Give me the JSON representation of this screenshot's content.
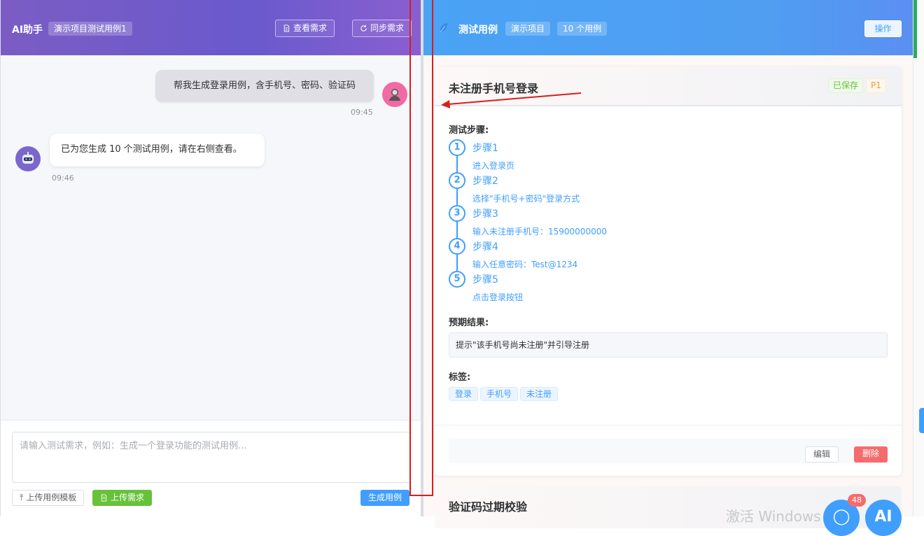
{
  "left_header": {
    "title": "AI助手",
    "project_tag": "演示项目测试用例1",
    "view_req_btn": "查看需求",
    "sync_req_btn": "同步需求"
  },
  "chat": {
    "user_message": "帮我生成登录用例，含手机号、密码、验证码",
    "user_time": "09:45",
    "ai_message": "已为您生成 10 个测试用例，请在右侧查看。",
    "ai_time": "09:46"
  },
  "input": {
    "placeholder": "请输入测试需求，例如：生成一个登录功能的测试用例...",
    "upload_template_btn": "上传用例模板",
    "upload_req_btn": "上传需求",
    "generate_btn": "生成用例"
  },
  "right_header": {
    "title": "测试用例",
    "project_tag": "演示项目",
    "count_tag": "10 个用例",
    "op_btn": "操作"
  },
  "case": {
    "title": "未注册手机号登录",
    "saved_badge": "已保存",
    "priority_badge": "P1",
    "steps_label": "测试步骤:",
    "steps": [
      {
        "num": "1",
        "title": "步骤1",
        "desc": "进入登录页"
      },
      {
        "num": "2",
        "title": "步骤2",
        "desc": "选择\"手机号+密码\"登录方式"
      },
      {
        "num": "3",
        "title": "步骤3",
        "desc": "输入未注册手机号：15900000000"
      },
      {
        "num": "4",
        "title": "步骤4",
        "desc": "输入任意密码：Test@1234"
      },
      {
        "num": "5",
        "title": "步骤5",
        "desc": "点击登录按钮"
      }
    ],
    "expected_label": "预期结果:",
    "expected_value": "提示\"该手机号尚未注册\"并引导注册",
    "tags_label": "标签:",
    "tags": [
      "登录",
      "手机号",
      "未注册"
    ],
    "edit_btn": "编辑",
    "delete_btn": "删除"
  },
  "next_case": {
    "title": "验证码过期校验"
  },
  "overlay": {
    "watermark": "激活 Windows",
    "notif_count": "48",
    "fab_label": "AI"
  },
  "colors": {
    "left_header": "#6a5acd",
    "right_header": "#4f9ef2",
    "primary": "#409eff",
    "danger": "#f56c6c",
    "success": "#67c23a",
    "annotation": "#d61f1f"
  }
}
